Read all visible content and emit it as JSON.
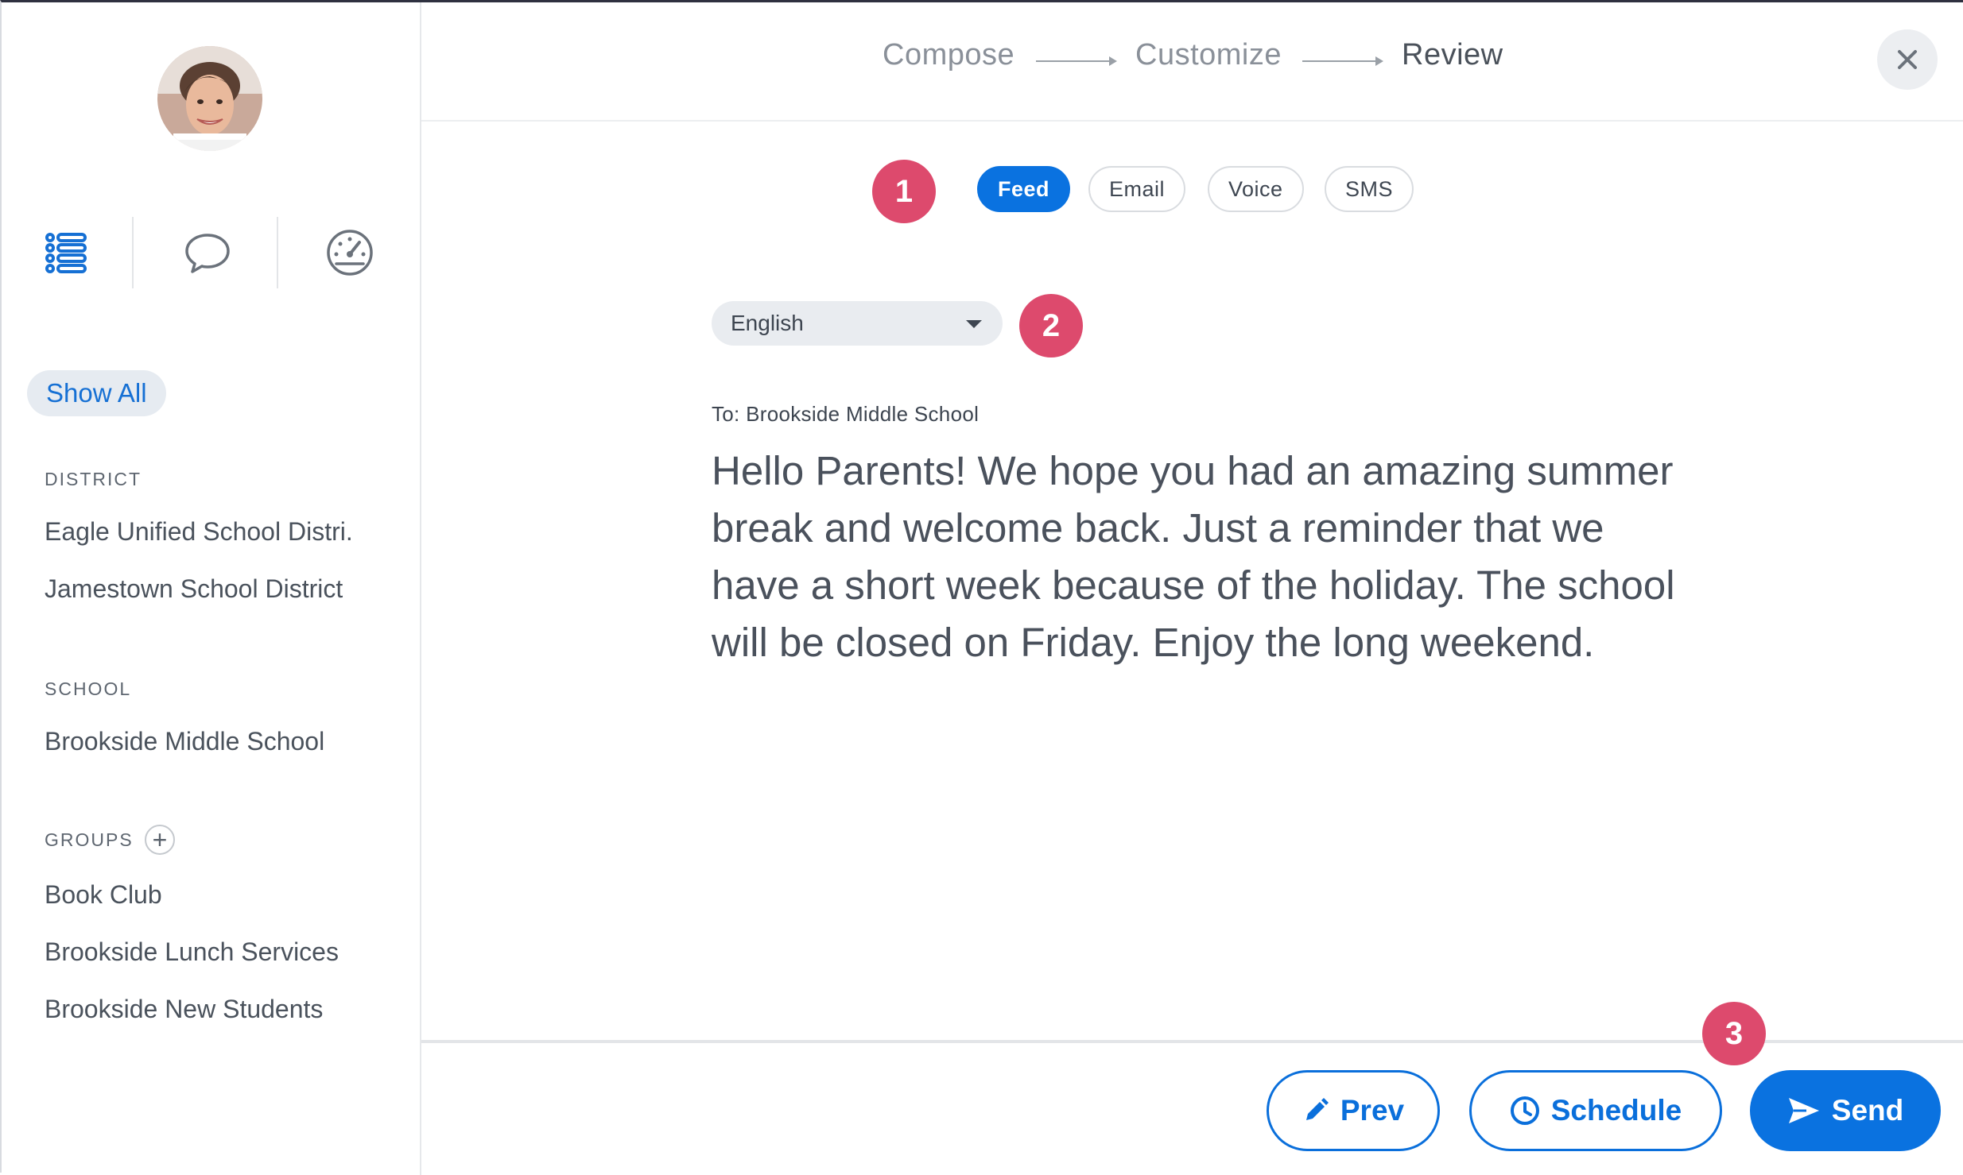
{
  "sidebar": {
    "show_all": "Show All",
    "sections": {
      "district": {
        "title": "DISTRICT",
        "items": [
          "Eagle Unified School Distri.",
          "Jamestown School District"
        ]
      },
      "school": {
        "title": "SCHOOL",
        "items": [
          "Brookside Middle School"
        ]
      },
      "groups": {
        "title": "GROUPS",
        "add": "+",
        "items": [
          "Book Club",
          "Brookside Lunch Services",
          "Brookside New Students"
        ]
      }
    },
    "nav_icons": [
      "list-icon",
      "chat-bubble-icon",
      "dashboard-gauge-icon"
    ]
  },
  "stepper": {
    "steps": [
      "Compose",
      "Customize",
      "Review"
    ],
    "active": "Review"
  },
  "close": "×",
  "channels": {
    "items": [
      "Feed",
      "Email",
      "Voice",
      "SMS"
    ],
    "selected": "Feed"
  },
  "language": {
    "selected": "English"
  },
  "message": {
    "to": "To: Brookside Middle School",
    "body": "Hello Parents! We hope you had an amazing summer break and welcome back. Just a reminder that we have a short week because of the holiday. The school will be closed on Friday. Enjoy the long weekend."
  },
  "badges": [
    "1",
    "2",
    "3"
  ],
  "actions": {
    "prev": "Prev",
    "schedule": "Schedule",
    "send": "Send"
  },
  "colors": {
    "accent": "#0a72e0",
    "badge": "#dd4a6d",
    "chip_bg": "#e9ecf0"
  }
}
